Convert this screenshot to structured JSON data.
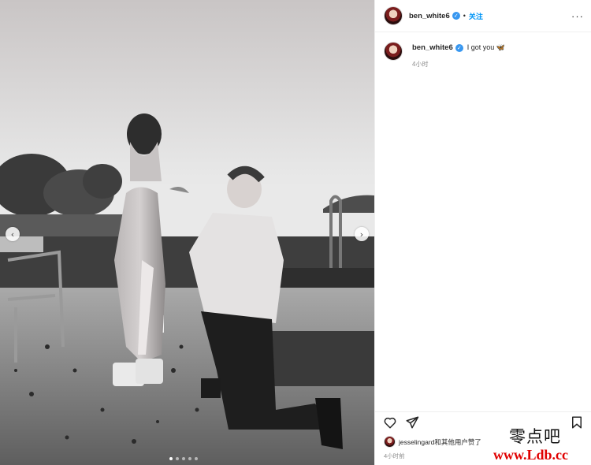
{
  "post": {
    "username": "ben_white6",
    "verified_mark": "✓",
    "separator": "•",
    "follow_label": "关注",
    "more_label": "···",
    "caption_text": "I got you 🦋",
    "caption_time": "4小时",
    "likes_text": "jesselingard和其他用户赞了",
    "post_time": "4小时前"
  },
  "carousel": {
    "prev_label": "‹",
    "next_label": "›",
    "slides": 5,
    "active_slide": 1
  },
  "icons": {
    "like": "heart-icon",
    "share": "send-icon",
    "save": "bookmark-icon",
    "more": "more-dots-icon"
  },
  "watermark": {
    "line1": "零点吧",
    "line2": "www.Ldb.cc",
    "line2_color": "#e00000"
  },
  "colors": {
    "accent": "#0095f6",
    "verified": "#3897f0",
    "muted": "#8e8e8e"
  }
}
